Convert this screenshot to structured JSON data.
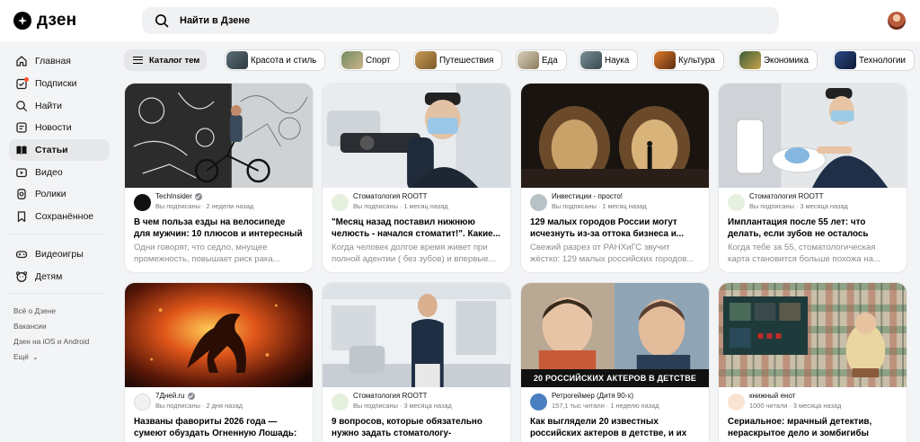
{
  "header": {
    "logo_text": "дзен",
    "search_placeholder": "Найти в Дзене"
  },
  "sidebar": {
    "items": [
      {
        "label": "Главная",
        "icon": "home-icon"
      },
      {
        "label": "Подписки",
        "icon": "subscriptions-icon"
      },
      {
        "label": "Найти",
        "icon": "search-icon"
      },
      {
        "label": "Новости",
        "icon": "news-icon"
      },
      {
        "label": "Статьи",
        "icon": "articles-icon",
        "active": true
      },
      {
        "label": "Видео",
        "icon": "video-icon"
      },
      {
        "label": "Ролики",
        "icon": "clips-icon"
      },
      {
        "label": "Сохранённое",
        "icon": "bookmark-icon"
      }
    ],
    "extra_items": [
      {
        "label": "Видеоигры",
        "icon": "gamepad-icon"
      },
      {
        "label": "Детям",
        "icon": "kids-icon"
      }
    ],
    "footer_links": [
      "Всё о Дзене",
      "Вакансии",
      "Дзен на iOS и Android",
      "Ещё"
    ]
  },
  "topics": {
    "catalog_label": "Каталог тем",
    "items": [
      "Красота и стиль",
      "Спорт",
      "Путешествия",
      "Еда",
      "Наука",
      "Культура",
      "Экономика",
      "Технологии"
    ]
  },
  "cards": [
    {
      "channel": "TechInsider",
      "verified": true,
      "sub": "Вы подписаны · 2 недели назад",
      "title": "В чем польза езды на велосипеде для мужчин: 10 плюсов и интересный факт...",
      "excerpt": "Одни говорят, что седло, мнущее промежность, повышает риск рака..."
    },
    {
      "channel": "Стоматология ROOTT",
      "verified": false,
      "sub": "Вы подписаны · 1 месяц назад",
      "title": "\"Месяц назад поставил нижнюю челюсть - начался стоматит!\". Какие...",
      "excerpt": "Когда человек долгое время живет при полной адентии ( без зубов) и впервые..."
    },
    {
      "channel": "Инвестиции - просто!",
      "verified": false,
      "sub": "Вы подписаны · 1 месяц назад",
      "title": "129 малых городов России могут исчезнуть из-за оттока бизнеса и...",
      "excerpt": "Свежий разрез от РАНХиГС звучит жёстко: 129 малых российских городов..."
    },
    {
      "channel": "Стоматология ROOTT",
      "verified": false,
      "sub": "Вы подписаны · 3 месяца назад",
      "title": "Имплантация после 55 лет: что делать, если зубов не осталось вообще и точн...",
      "excerpt": "Когда тебе за 55, стоматологическая карта становится больше похожа на..."
    },
    {
      "channel": "7Дней.ru",
      "verified": true,
      "sub": "Вы подписаны · 2 дня назад",
      "title": "Названы фавориты 2026 года — сумеют обуздать Огненную Лошадь:",
      "excerpt": ""
    },
    {
      "channel": "Стоматология ROOTT",
      "verified": false,
      "sub": "Вы подписаны · 3 месяца назад",
      "title": "9 вопросов, которые обязательно нужно задать стоматологу-имплантологу пер...",
      "excerpt": ""
    },
    {
      "channel": "Ретрогеймер (Дитя 90-х)",
      "verified": false,
      "sub": "157,1 тыс читали · 1 неделю назад",
      "title": "Как выглядели 20 известных российских актеров в детстве, и их первые шаги в...",
      "excerpt": "",
      "image_caption": "20 РОССИЙСКИХ АКТЕРОВ В ДЕТСТВЕ"
    },
    {
      "channel": "книжный енот",
      "verified": false,
      "sub": "1000 читали · 3 месяца назад",
      "title": "Сериальное: мрачный детектив, нераскрытое дело и зомбигибы",
      "excerpt": ""
    }
  ]
}
